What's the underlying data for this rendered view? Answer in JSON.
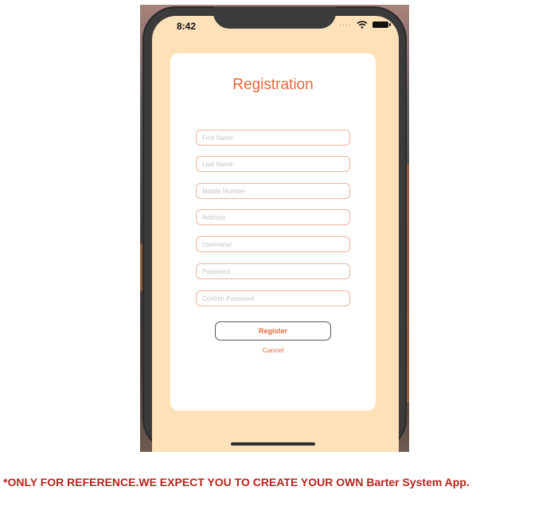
{
  "status_bar": {
    "time": "8:42",
    "signal_icon": "cellular-dots-icon",
    "wifi_icon": "wifi-icon",
    "battery_icon": "battery-icon"
  },
  "form": {
    "title": "Registration",
    "fields": [
      {
        "name": "first-name-field",
        "placeholder": "First Name",
        "value": ""
      },
      {
        "name": "last-name-field",
        "placeholder": "Last Name",
        "value": ""
      },
      {
        "name": "mobile-number-field",
        "placeholder": "Mobile Number",
        "value": ""
      },
      {
        "name": "address-field",
        "placeholder": "Address",
        "value": ""
      },
      {
        "name": "username-field",
        "placeholder": "Username",
        "value": ""
      },
      {
        "name": "password-field",
        "placeholder": "Password",
        "value": ""
      },
      {
        "name": "confirm-password-field",
        "placeholder": "Confrim Password",
        "value": ""
      }
    ],
    "register_label": "Register",
    "cancel_label": "Cancel"
  },
  "note": "*ONLY FOR REFERENCE.WE EXPECT YOU TO CREATE YOUR OWN Barter System App.",
  "colors": {
    "accent": "#e8673a",
    "screen_bg": "#fde2b9",
    "card_bg": "#ffffff",
    "field_border": "#f0b39a",
    "note_text": "#b3261e"
  }
}
